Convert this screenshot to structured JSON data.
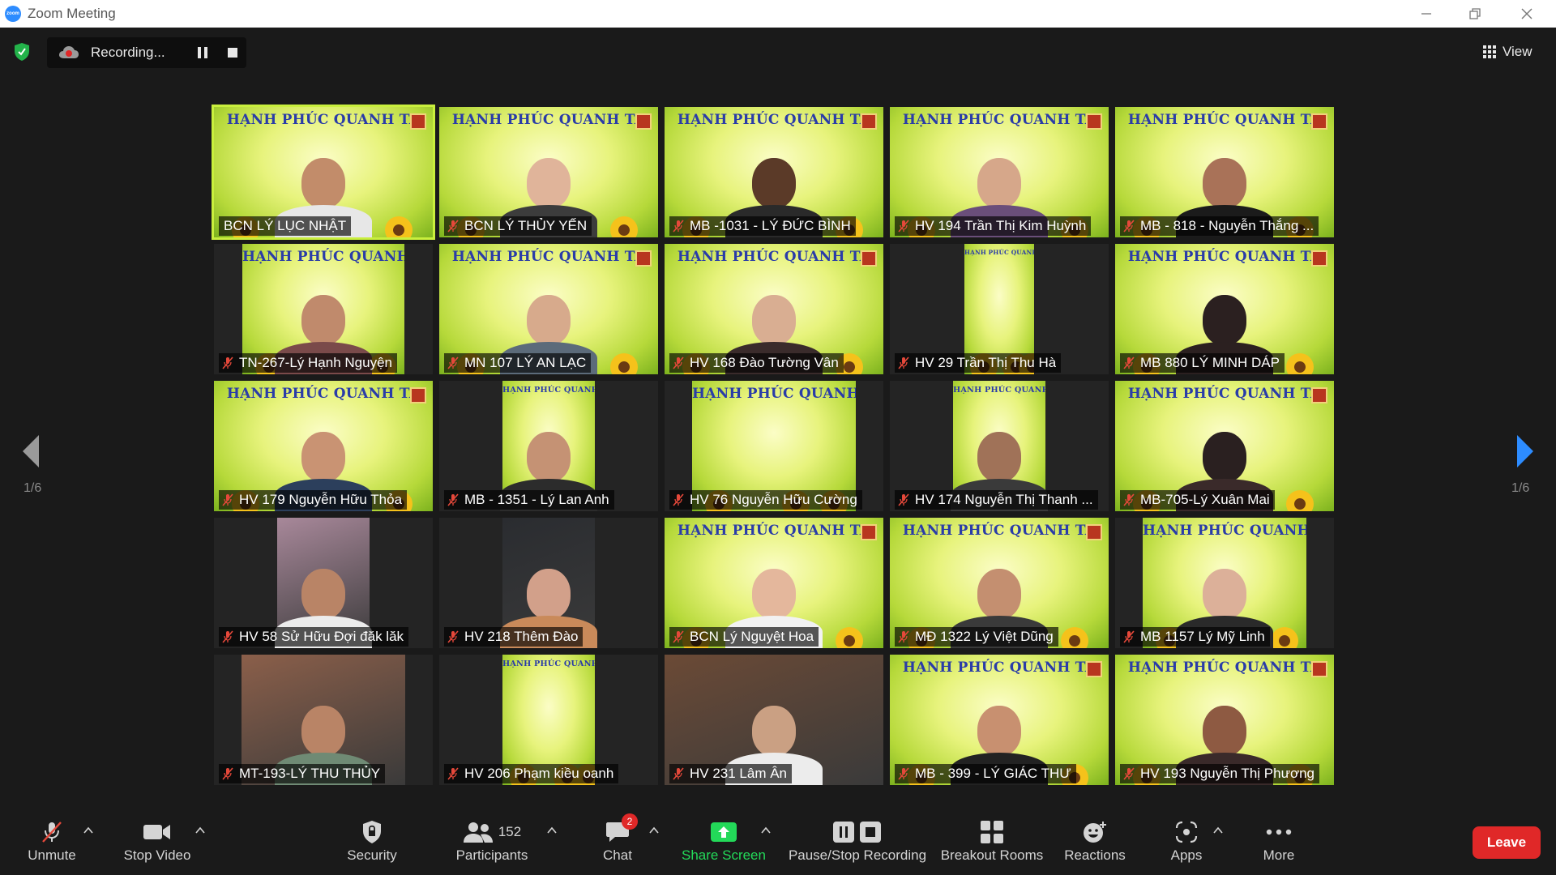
{
  "window": {
    "title": "Zoom Meeting",
    "app_logo_text": "zoom"
  },
  "recording": {
    "label": "Recording..."
  },
  "view": {
    "label": "View"
  },
  "pagination": {
    "left": "1/6",
    "right": "1/6"
  },
  "participants_grid": [
    {
      "name": "BCN LÝ LỤC NHẬT",
      "muted": false,
      "active": true,
      "bg": "full",
      "skin": "#c28c6a",
      "shirt": "#e7e7e7"
    },
    {
      "name": "BCN LÝ THỦY YẾN",
      "muted": true,
      "bg": "full",
      "skin": "#e0b49a",
      "shirt": "#3c3c3c"
    },
    {
      "name": "MB -1031 - LÝ ĐỨC BÌNH",
      "muted": true,
      "bg": "full",
      "skin": "#5b3a28",
      "shirt": "#2a2a2a"
    },
    {
      "name": "HV 194 Trần Thị Kim Huỳnh",
      "muted": true,
      "bg": "full",
      "skin": "#d6a78a",
      "shirt": "#6a4e7a"
    },
    {
      "name": "MB - 818 - Nguyễn Thắng ...",
      "muted": true,
      "bg": "full",
      "skin": "#a97258",
      "shirt": "#1b1b1b"
    },
    {
      "name": "TN-267-Lý Hạnh Nguyện",
      "muted": true,
      "bg": "narrow",
      "w": 200,
      "skin": "#c08a6c",
      "shirt": "#7a4a4a"
    },
    {
      "name": "MN 107 LÝ AN LẠC",
      "muted": true,
      "bg": "full",
      "skin": "#d7aa8c",
      "shirt": "#5c6b7a"
    },
    {
      "name": "HV 168 Đào Tường Vân",
      "muted": true,
      "bg": "full",
      "skin": "#d9ae92",
      "shirt": "#3a2b2b"
    },
    {
      "name": "HV 29 Trần Thị Thu Hà",
      "muted": true,
      "bg": "narrow",
      "w": 86,
      "skin": null,
      "shirt": null
    },
    {
      "name": "MB 880 LÝ MINH DÁP",
      "muted": true,
      "bg": "full",
      "skin": "#2b2020",
      "shirt": "#2b2020"
    },
    {
      "name": "HV 179 Nguyễn Hữu Thỏa",
      "muted": true,
      "bg": "full",
      "skin": "#c99373",
      "shirt": "#2c3f5c"
    },
    {
      "name": "MB - 1351 - Lý Lan Anh",
      "muted": true,
      "bg": "narrow",
      "w": 114,
      "skin": "#c59274",
      "shirt": "#2c2c2c"
    },
    {
      "name": "HV 76 Nguyễn Hữu Cường",
      "muted": true,
      "bg": "narrow",
      "w": 202,
      "skin": null,
      "shirt": null
    },
    {
      "name": "HV 174 Nguyễn Thị Thanh ...",
      "muted": true,
      "bg": "narrow",
      "w": 114,
      "skin": "#a07258",
      "shirt": "#3a3a3a"
    },
    {
      "name": "MB-705-Lý Xuân Mai",
      "muted": true,
      "bg": "full",
      "skin": "#2a2020",
      "shirt": "#3a2a2a"
    },
    {
      "name": "HV 58 Sử Hữu Đợi đăk lăk",
      "muted": true,
      "bg": "photo",
      "w": 114,
      "photo": "#a8889a",
      "skin": "#b98466",
      "shirt": "#ececec"
    },
    {
      "name": "HV 218  Thêm Đào",
      "muted": true,
      "bg": "photo",
      "w": 114,
      "photo": "#2a2c30",
      "skin": "#d2a08a",
      "shirt": "#c98a5a"
    },
    {
      "name": "BCN Lý Nguyệt Hoa",
      "muted": true,
      "bg": "full",
      "skin": "#e4b79c",
      "shirt": "#f2f2f2"
    },
    {
      "name": "MĐ 1322 Lý Việt Dũng",
      "muted": true,
      "bg": "full",
      "skin": "#c48f70",
      "shirt": "#3a3a3a"
    },
    {
      "name": "MB 1157 Lý Mỹ Linh",
      "muted": true,
      "bg": "narrow",
      "w": 202,
      "skin": "#dcb099",
      "shirt": "#2a2a2a"
    },
    {
      "name": "MT-193-LÝ THU THỦY",
      "muted": true,
      "bg": "photo",
      "w": 202,
      "photo": "#8b5f4a",
      "skin": "#b98466",
      "shirt": "#6f8a74"
    },
    {
      "name": "HV 206 Phạm kiều oanh",
      "muted": true,
      "bg": "narrow",
      "w": 114,
      "skin": null,
      "shirt": null
    },
    {
      "name": "HV 231 Lâm Ân",
      "muted": true,
      "bg": "photo",
      "w": 270,
      "photo": "#6b4a36",
      "skin": "#caa083",
      "shirt": "#ececec"
    },
    {
      "name": "MB - 399 - LÝ GIÁC THƯ",
      "muted": true,
      "bg": "full",
      "skin": "#c89070",
      "shirt": "#222222"
    },
    {
      "name": "HV 193 Nguyễn Thị Phương",
      "muted": true,
      "bg": "full",
      "skin": "#8e5a42",
      "shirt": "#3a2a2a"
    }
  ],
  "banner": {
    "title": "HẠNH PHÚC QUANH TA"
  },
  "toolbar": {
    "unmute": "Unmute",
    "stop_video": "Stop Video",
    "security": "Security",
    "participants": "Participants",
    "participants_count": "152",
    "chat": "Chat",
    "chat_badge": "2",
    "share_screen": "Share Screen",
    "pause_stop_recording": "Pause/Stop Recording",
    "breakout_rooms": "Breakout Rooms",
    "reactions": "Reactions",
    "apps": "Apps",
    "more": "More",
    "leave": "Leave"
  },
  "colors": {
    "accent_green": "#23d959",
    "leave_red": "#e02828",
    "active_speaker": "#c9ef3d",
    "mute_red": "#e5483a"
  }
}
